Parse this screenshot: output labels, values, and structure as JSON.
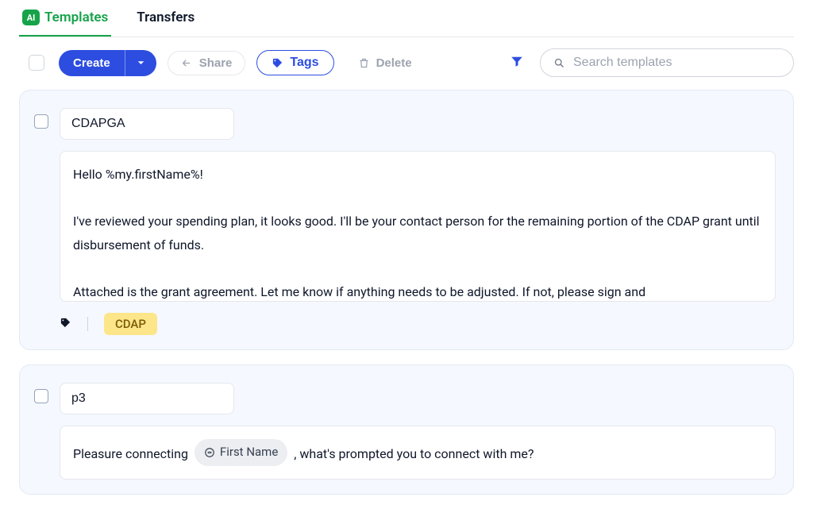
{
  "tabs": {
    "templates": "Templates",
    "transfers": "Transfers",
    "ai_badge": "AI"
  },
  "toolbar": {
    "create": "Create",
    "share": "Share",
    "tags": "Tags",
    "delete": "Delete",
    "search_placeholder": "Search templates"
  },
  "templates": [
    {
      "title": "CDAPGA",
      "body": "Hello %my.firstName%!\n\nI've reviewed your spending plan, it looks good. I'll be your contact person for the remaining portion of the CDAP grant until disbursement of funds.\n\nAttached is the grant agreement. Let me know if anything needs to be adjusted. If not, please sign and",
      "tags": [
        "CDAP"
      ]
    },
    {
      "title": "p3",
      "body_prefix": "Pleasure connecting ",
      "placeholder": "First Name",
      "body_suffix": ", what's prompted you to connect with me?"
    }
  ]
}
